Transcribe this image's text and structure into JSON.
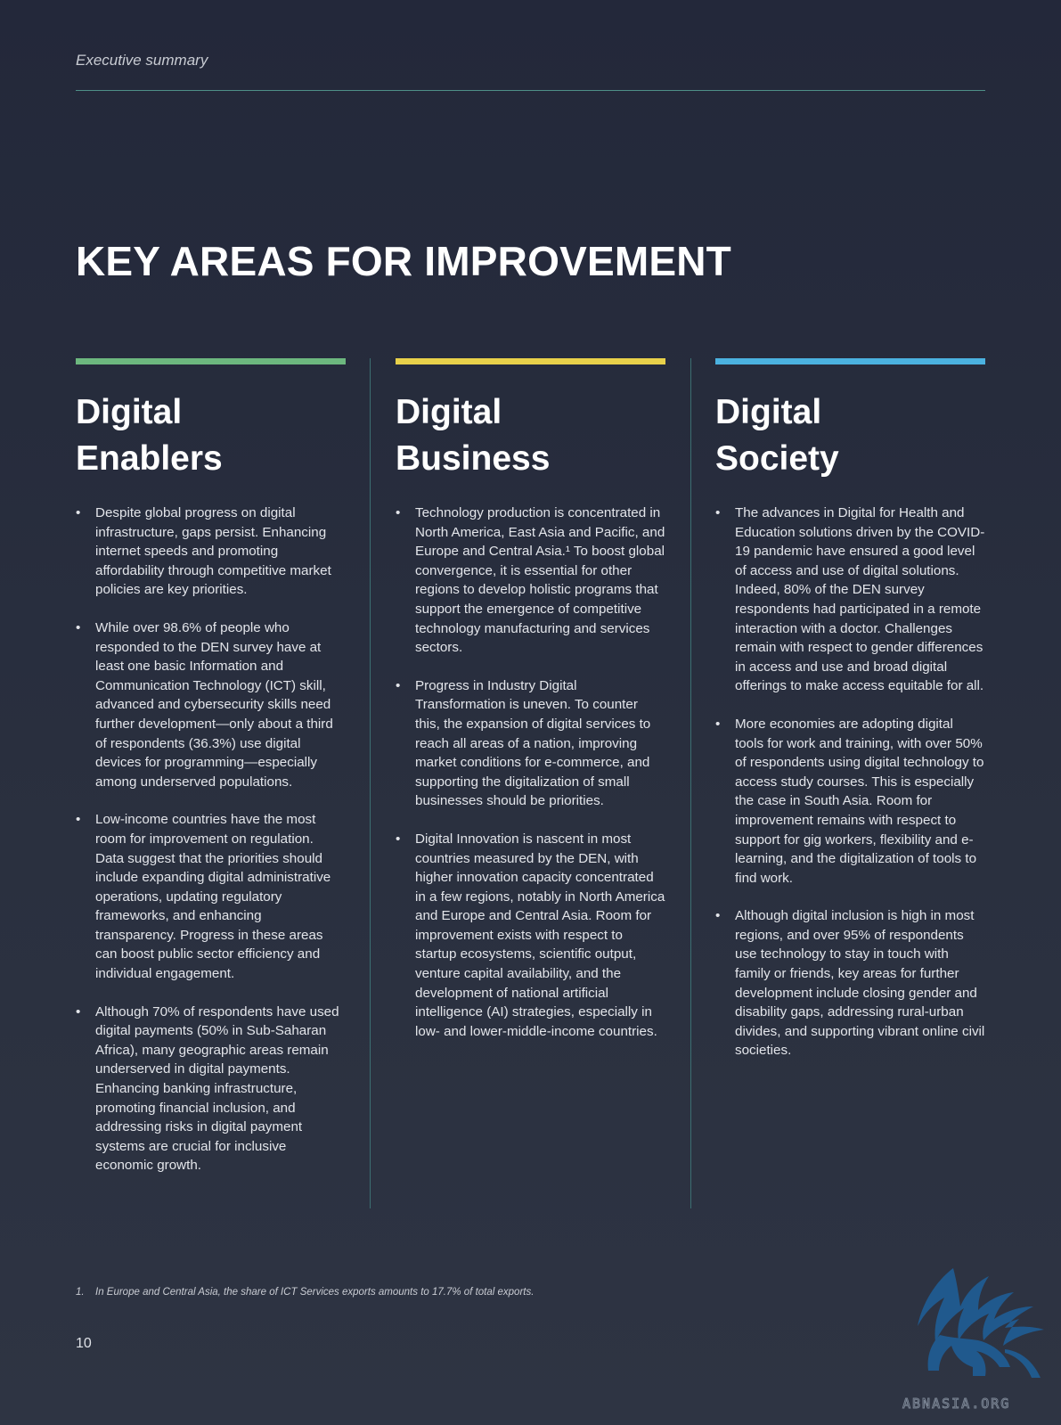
{
  "header": {
    "section": "Executive summary"
  },
  "title": "KEY AREAS FOR IMPROVEMENT",
  "colors": {
    "enablers": "#6db87f",
    "business": "#e8d14a",
    "society": "#4bb2e0",
    "background": "#262b3a"
  },
  "columns": [
    {
      "heading": "Digital Enablers",
      "bullets": [
        "Despite global progress on digital infrastructure, gaps persist. Enhancing internet speeds and promoting affordability through competitive market policies are key priorities.",
        "While over 98.6% of people who responded to the DEN survey have at least one basic Information and Communication Technology (ICT) skill, advanced and cybersecurity skills need further development—only about a third of respondents (36.3%) use digital devices for programming—especially among underserved populations.",
        "Low-income countries have the most room for improvement on regulation. Data suggest that the priorities should include expanding digital administrative operations, updating regulatory frameworks, and enhancing transparency. Progress in these areas can boost public sector efficiency and individual engagement.",
        "Although 70% of respondents have used digital payments (50% in Sub-Saharan Africa), many geographic areas remain underserved in digital payments. Enhancing banking infrastructure, promoting financial inclusion, and addressing risks in digital payment systems are crucial for inclusive economic growth."
      ]
    },
    {
      "heading": "Digital Business",
      "bullets": [
        "Technology production is concentrated in North America, East Asia and Pacific, and Europe and Central Asia.¹ To boost global convergence, it is essential for other regions to develop holistic programs that support the emergence of competitive technology manufacturing and services sectors.",
        "Progress in Industry Digital Transformation is uneven. To counter this, the expansion of digital services to reach all areas of a nation, improving market conditions for e-commerce, and supporting the digitalization of small businesses should be priorities.",
        "Digital Innovation is nascent in most countries measured by the DEN, with higher innovation capacity concentrated in a few regions, notably in North America and Europe and Central Asia. Room for improvement exists with respect to startup ecosystems, scientific output, venture capital availability, and the development of national artificial intelligence (AI) strategies, especially in low- and lower-middle-income countries."
      ]
    },
    {
      "heading": "Digital Society",
      "bullets": [
        "The advances in Digital for Health and Education solutions driven by the COVID-19 pandemic have ensured a good level of access and use of digital solutions. Indeed, 80% of the DEN survey respondents had participated in a remote interaction with a doctor. Challenges remain with respect to gender differences in access and use and broad digital offerings to make access equitable for all.",
        "More economies are adopting digital tools for work and training, with over 50% of respondents using digital technology to access study courses. This is especially the case in South Asia. Room for improvement remains with respect to support for gig workers, flexibility and e-learning, and the digitalization of tools to find work.",
        "Although digital inclusion is high in most regions, and over 95% of respondents use technology to stay in touch with family or friends, key areas for further development include closing gender and disability gaps, addressing rural-urban divides, and supporting vibrant online civil societies."
      ]
    }
  ],
  "footnote": {
    "number": "1.",
    "text": "In Europe and Central Asia, the share of ICT Services exports amounts to 17.7% of total exports."
  },
  "page_number": "10",
  "watermark": "ABNASIA.ORG"
}
